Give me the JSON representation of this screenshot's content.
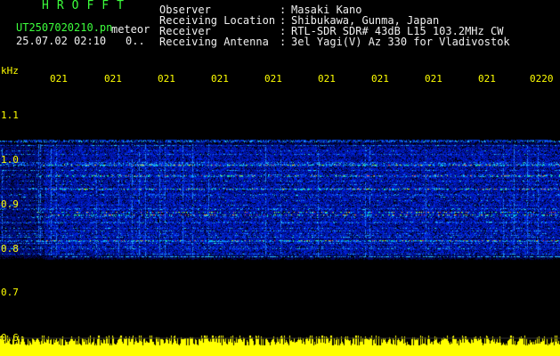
{
  "header": {
    "logo": "HROFFT",
    "file_name": "UT2507020210.pn",
    "mode": "meteor",
    "datetime": "25.07.02 02:10",
    "extra": "0.."
  },
  "info": [
    {
      "label": "Observer",
      "value": "Masaki Kano"
    },
    {
      "label": "Receiving Location",
      "value": "Shibukawa, Gunma, Japan"
    },
    {
      "label": "Receiver",
      "value": "RTL-SDR SDR# 43dB L15 103.2MHz CW"
    },
    {
      "label": "Receiving Antenna",
      "value": "3el Yagi(V) Az 330 for Vladivostok"
    }
  ],
  "axis": {
    "freq_unit": "kHz",
    "time_ticks": [
      "021",
      "021",
      "021",
      "021",
      "021",
      "021",
      "021",
      "021",
      "021",
      "0220"
    ],
    "freq_ticks": [
      {
        "label": "1.1",
        "value": 1.1
      },
      {
        "label": "1.0",
        "value": 1.0
      },
      {
        "label": "0.9",
        "value": 0.9
      },
      {
        "label": "0.8",
        "value": 0.8
      },
      {
        "label": "0.7",
        "value": 0.7
      },
      {
        "label": "0.6",
        "value": 0.6
      }
    ]
  },
  "colors": {
    "text_green": "#3cff3c",
    "text_white": "#f0f0f0",
    "text_yellow": "#ffff00",
    "background": "#000000"
  }
}
